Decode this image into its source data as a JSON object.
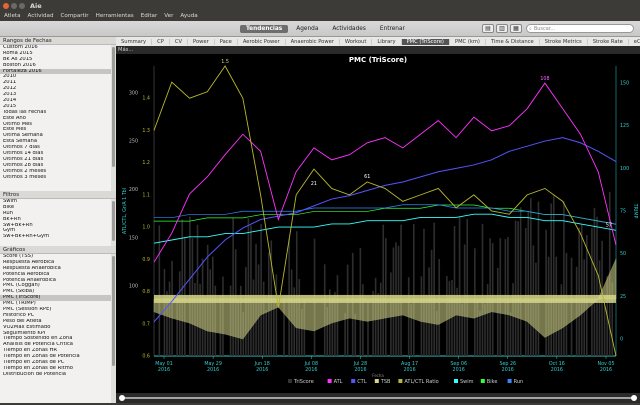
{
  "app": {
    "title": "Aie"
  },
  "menu": [
    "Atleta",
    "Actividad",
    "Compartir",
    "Herramientas",
    "Editar",
    "Ver",
    "Ayuda"
  ],
  "toolbar": {
    "tabs": [
      {
        "label": "Tendencias",
        "active": true
      },
      {
        "label": "Agenda",
        "active": false
      },
      {
        "label": "Actividades",
        "active": false
      },
      {
        "label": "Entrenar",
        "active": false
      }
    ],
    "search_placeholder": "Buscar..."
  },
  "sidebar": {
    "date_ranges": {
      "header": "Rangos de Fechas",
      "items": [
        "Custom 2016",
        "Roma 2015",
        "Bk As 2015",
        "Boston 2016",
        "Fortaleza 2016",
        "2010",
        "2011",
        "2012",
        "2013",
        "2014",
        "2015",
        "Todas las Fechas",
        "Este Año",
        "Último Mes",
        "Este Mes",
        "Última Semana",
        "Esta Semana",
        "Últimos 7 días",
        "Últimos 14 días",
        "Últimos 21 días",
        "Últimos 28 días",
        "Últimos 2 meses",
        "Últimos 3 meses"
      ],
      "selected_index": 4
    },
    "filters": {
      "header": "Filtros",
      "items": [
        "Swim",
        "Bike",
        "Run",
        "Bk+Rn",
        "Sw+Bk+Rn",
        "Gym",
        "Sw+Bk+Rn+Gym"
      ]
    },
    "charts": {
      "header": "Gráficos",
      "items": [
        "Score (TSS)",
        "Respuesta Aeróbica",
        "Respuesta Anaeróbica",
        "Potencia Aeróbica",
        "Potencia Anaeróbica",
        "PMC (Coggan)",
        "PMC (Skiba)",
        "PMC (TriScore)",
        "PMC (TRIMP)",
        "PMC (Session RPE)",
        "Histórico PC",
        "Peso del Atleta",
        "VO2Máx Estimado",
        "Seguimiento KPI",
        "Tiempo Sostenido en Zona",
        "Análisis de Potencia Crítica",
        "Tiempo en Zonas HR",
        "Tiempo en Zonas de Potencia",
        "Tiempo en Zonas de PC",
        "Tiempo en Zonas de Ritmo",
        "Distribución de Potencia"
      ],
      "selected_index": 7
    }
  },
  "subtabs": [
    "Summary",
    "CP",
    "CV",
    "Power",
    "Pace",
    "Aerobic Power",
    "Anaerobic Power",
    "Workout",
    "Library",
    "PMC (TriScore)",
    "PMC (km)",
    "Time & Distance",
    "Stroke Metrics",
    "Stroke Rate",
    "eCP (1.M)",
    "TriScore"
  ],
  "subtab_active": 9,
  "mas_label": "Más...",
  "chart_data": {
    "type": "line",
    "title": "PMC (TriScore)",
    "xlabel": "Fecha",
    "ylabel_left": "ATL/CTL, Gr/A 1 Tbl",
    "ylabel_right": "TRIMP",
    "x_ticks": [
      "May 01\n2016",
      "May 29\n2016",
      "Jun 18\n2016",
      "Jul 08\n2016",
      "Jul 28\n2016",
      "Aug 17\n2016",
      "Sep 06\n2016",
      "Sep 26\n2016",
      "Oct 16\n2016",
      "Nov 05\n2016"
    ],
    "y_left_ticks": [
      "0.6",
      "0.7",
      "0.8",
      "0.9",
      "1.0",
      "1.1",
      "1.2",
      "1.3",
      "1.4"
    ],
    "y_left_ticks2": [
      "100",
      "150",
      "200",
      "250",
      "300"
    ],
    "y_right_ticks": [
      "0",
      "25",
      "50",
      "75",
      "100",
      "125",
      "150"
    ],
    "legend": [
      {
        "name": "TriScore",
        "color": "#333333"
      },
      {
        "name": "ATL",
        "color": "#ff33ff"
      },
      {
        "name": "CTL",
        "color": "#5555ff"
      },
      {
        "name": "TSB",
        "color": "#d8d88a"
      },
      {
        "name": "ATL/CTL Ratio",
        "color": "#b8b830"
      },
      {
        "name": "Swim",
        "color": "#33ffff"
      },
      {
        "name": "Bike",
        "color": "#33ff33"
      },
      {
        "name": "Run",
        "color": "#3388ff"
      }
    ],
    "annotations": [
      "1.5",
      "108",
      "21",
      "61",
      "57"
    ],
    "series": [
      {
        "name": "ATL",
        "values": [
          45,
          62,
          85,
          95,
          108,
          120,
          110,
          70,
          98,
          112,
          105,
          108,
          115,
          118,
          112,
          120,
          128,
          118,
          130,
          122,
          125,
          135,
          150,
          135,
          120,
          98,
          55
        ]
      },
      {
        "name": "CTL",
        "values": [
          10,
          22,
          35,
          48,
          58,
          65,
          70,
          72,
          74,
          78,
          82,
          84,
          87,
          90,
          92,
          95,
          98,
          100,
          102,
          105,
          110,
          113,
          116,
          118,
          115,
          110,
          104
        ]
      },
      {
        "name": "TSB",
        "values": [
          -8,
          -12,
          -15,
          -20,
          -22,
          -25,
          -10,
          -5,
          -18,
          -20,
          -15,
          -12,
          -14,
          -12,
          -10,
          -14,
          -16,
          -10,
          -12,
          -8,
          -10,
          -14,
          -24,
          -18,
          -10,
          0,
          25
        ]
      },
      {
        "name": "ATL/CTL Ratio",
        "values": [
          1.3,
          1.45,
          1.4,
          1.42,
          1.5,
          1.4,
          1.1,
          0.75,
          1.1,
          1.18,
          1.12,
          1.1,
          1.14,
          1.12,
          1.08,
          1.1,
          1.12,
          1.06,
          1.1,
          1.05,
          1.04,
          1.1,
          1.12,
          1.08,
          0.98,
          0.85,
          0.6
        ]
      },
      {
        "name": "Swim",
        "values": [
          0.95,
          0.96,
          0.97,
          0.97,
          0.98,
          0.98,
          0.99,
          1.0,
          1.0,
          1.0,
          1.01,
          1.01,
          1.02,
          1.02,
          1.02,
          1.03,
          1.03,
          1.03,
          1.04,
          1.04,
          1.03,
          1.03,
          1.02,
          1.02,
          1.01,
          1.0,
          0.99
        ]
      },
      {
        "name": "Bike",
        "values": [
          1.0,
          1.0,
          1.0,
          1.01,
          1.01,
          1.01,
          1.02,
          1.02,
          1.02,
          1.03,
          1.03,
          1.03,
          1.03,
          1.04,
          1.04,
          1.04,
          1.05,
          1.05,
          1.05,
          1.04,
          1.04,
          1.03,
          1.02,
          1.02,
          1.01,
          1.0,
          0.99
        ]
      },
      {
        "name": "Run",
        "values": [
          1.02,
          1.02,
          1.03,
          1.03,
          1.03,
          1.04,
          1.04,
          1.04,
          1.04,
          1.05,
          1.05,
          1.05,
          1.05,
          1.05,
          1.06,
          1.06,
          1.06,
          1.05,
          1.05,
          1.05,
          1.04,
          1.04,
          1.03,
          1.03,
          1.02,
          1.01,
          1.0
        ]
      }
    ]
  }
}
